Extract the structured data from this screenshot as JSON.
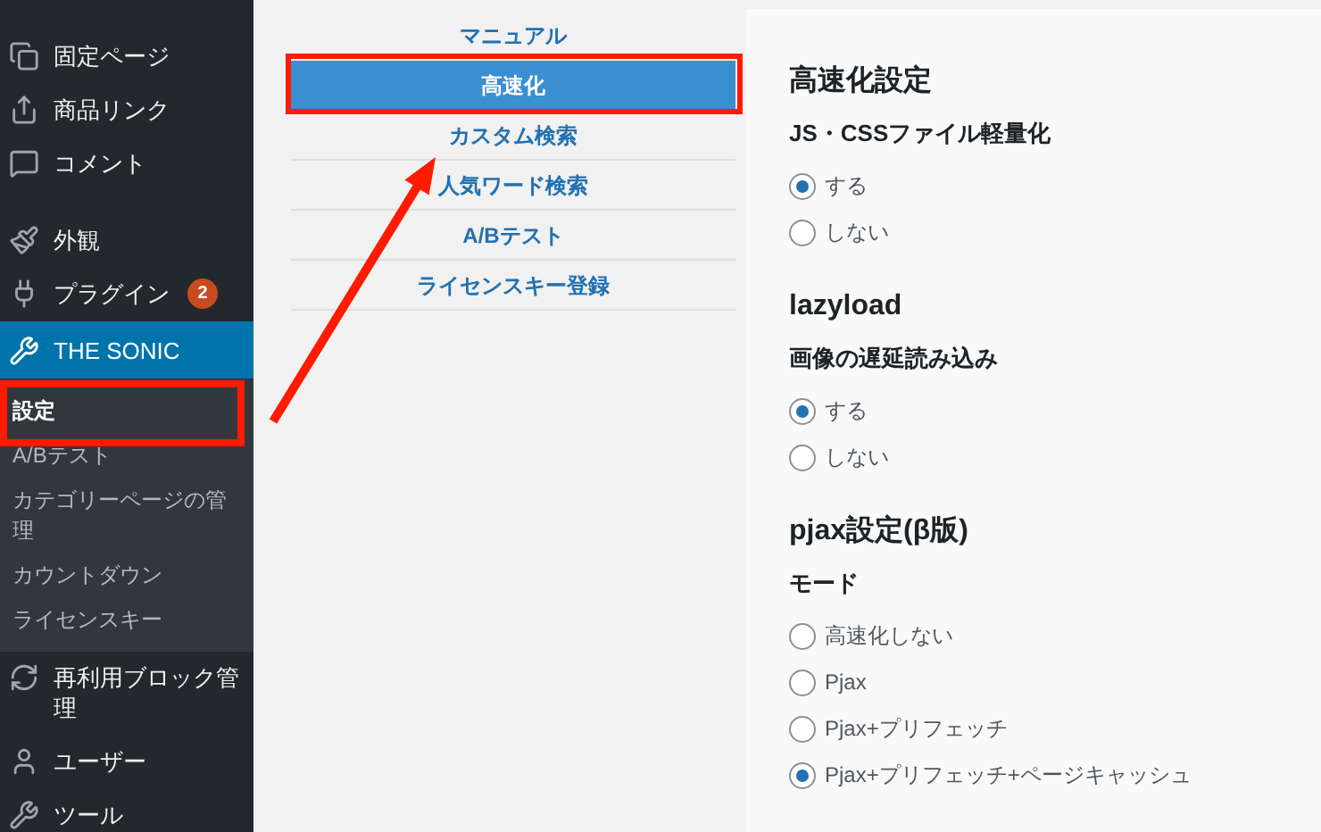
{
  "sidebar": {
    "groups": [
      [
        {
          "label": "固定ページ",
          "selected": false
        },
        {
          "label": "商品リンク",
          "selected": false
        },
        {
          "label": "コメント",
          "selected": false
        }
      ],
      [
        {
          "label": "外観",
          "selected": false
        },
        {
          "label": "プラグイン",
          "selected": false,
          "badge": "2"
        },
        {
          "label": "THE SONIC",
          "selected": true,
          "children": [
            {
              "label": "設定",
              "selected": true
            },
            {
              "label": "A/Bテスト",
              "selected": false
            },
            {
              "label": "カテゴリーページの管理",
              "selected": false
            },
            {
              "label": "カウントダウン",
              "selected": false
            },
            {
              "label": "ライセンスキー",
              "selected": false
            }
          ]
        },
        {
          "label": "再利用ブロック管理",
          "selected": false
        },
        {
          "label": "ユーザー",
          "selected": false
        },
        {
          "label": "ツール",
          "selected": false
        }
      ]
    ]
  },
  "tabs": [
    {
      "label": "マニュアル",
      "selected": false
    },
    {
      "label": "高速化",
      "selected": true
    },
    {
      "label": "カスタム検索",
      "selected": false
    },
    {
      "label": "人気ワード検索",
      "selected": false
    },
    {
      "label": "A/Bテスト",
      "selected": false
    },
    {
      "label": "ライセンスキー登録",
      "selected": false
    }
  ],
  "sections": [
    {
      "title": "高速化設定",
      "fields": [
        {
          "label": "JS・CSSファイル軽量化",
          "options": [
            {
              "label": "する",
              "selected": true
            },
            {
              "label": "しない",
              "selected": false
            }
          ]
        }
      ]
    },
    {
      "title": "lazyload",
      "fields": [
        {
          "label": "画像の遅延読み込み",
          "options": [
            {
              "label": "する",
              "selected": true
            },
            {
              "label": "しない",
              "selected": false
            }
          ]
        }
      ]
    },
    {
      "title": "pjax設定(β版)",
      "fields": [
        {
          "label": "モード",
          "options": [
            {
              "label": "高速化しない",
              "selected": false
            },
            {
              "label": "Pjax",
              "selected": false
            },
            {
              "label": "Pjax+プリフェッチ",
              "selected": false
            },
            {
              "label": "Pjax+プリフェッチ+ページキャッシュ",
              "selected": true
            }
          ]
        }
      ]
    }
  ]
}
